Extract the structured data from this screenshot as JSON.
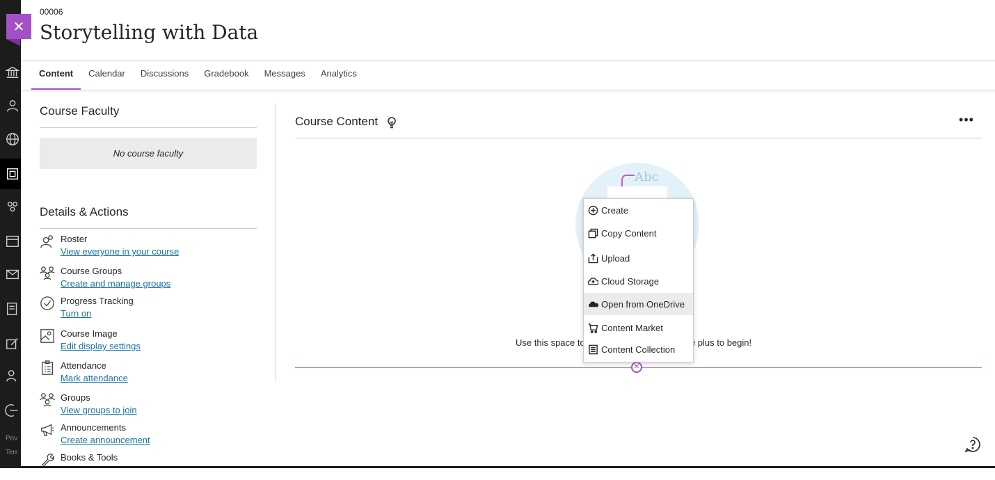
{
  "course": {
    "id": "00006",
    "title": "Storytelling with Data"
  },
  "tabs": [
    {
      "label": "Content",
      "active": true
    },
    {
      "label": "Calendar"
    },
    {
      "label": "Discussions"
    },
    {
      "label": "Gradebook"
    },
    {
      "label": "Messages"
    },
    {
      "label": "Analytics"
    }
  ],
  "faculty": {
    "title": "Course Faculty",
    "empty": "No course faculty"
  },
  "details": {
    "title": "Details & Actions",
    "items": [
      {
        "title": "Roster",
        "link": "View everyone in your course",
        "icon": "roster-icon"
      },
      {
        "title": "Course Groups",
        "link": "Create and manage groups",
        "icon": "groups-icon"
      },
      {
        "title": "Progress Tracking",
        "link": "Turn on",
        "icon": "progress-check-icon"
      },
      {
        "title": "Course Image",
        "link": "Edit display settings",
        "icon": "image-icon"
      },
      {
        "title": "Attendance",
        "link": "Mark attendance",
        "icon": "attendance-icon"
      },
      {
        "title": "Groups",
        "link": "View groups to join",
        "icon": "groups-icon"
      },
      {
        "title": "Announcements",
        "link": "Create announcement",
        "icon": "megaphone-icon"
      },
      {
        "title": "Books & Tools",
        "link": "",
        "icon": "wrench-icon"
      }
    ]
  },
  "content": {
    "title": "Course Content",
    "empty_before": "Use this space to",
    "empty_after": "he plus to begin!",
    "illustration_text": "Abc"
  },
  "menu": {
    "items": [
      {
        "label": "Create",
        "icon": "plus-circle-icon"
      },
      {
        "label": "Copy Content",
        "icon": "copy-icon"
      },
      {
        "label": "Upload",
        "icon": "upload-icon"
      },
      {
        "label": "Cloud Storage",
        "icon": "cloud-icon"
      },
      {
        "label": "Open from OneDrive",
        "icon": "onedrive-icon",
        "highlighted": true
      },
      {
        "label": "Content Market",
        "icon": "market-icon"
      },
      {
        "label": "Content Collection",
        "icon": "collection-icon"
      }
    ]
  },
  "rail": {
    "legal_1": "Priv",
    "legal_2": "Terr"
  },
  "colors": {
    "accent": "#a351c7",
    "link": "#1873a5",
    "rail": "#1c1c1c"
  }
}
